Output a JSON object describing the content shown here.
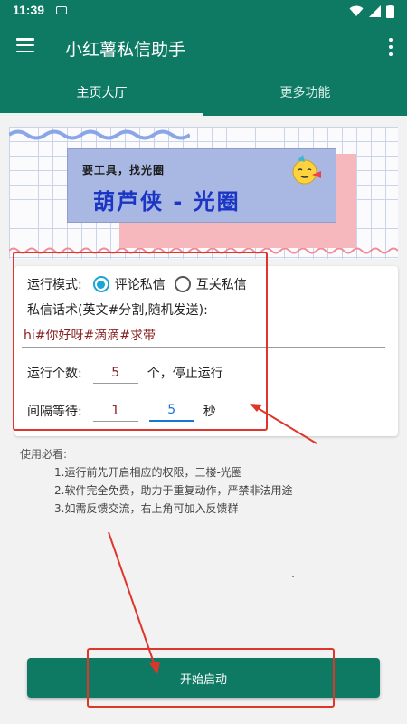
{
  "status_bar": {
    "time": "11:39"
  },
  "app_bar": {
    "title": "小红薯私信助手"
  },
  "tabs": [
    {
      "label": "主页大厅",
      "active": true
    },
    {
      "label": "更多功能",
      "active": false
    }
  ],
  "banner": {
    "small_text": "要工具，找光圈",
    "big_text": "葫芦侠 - 光圈"
  },
  "settings": {
    "mode_label": "运行模式:",
    "mode_options": [
      {
        "label": "评论私信",
        "checked": true
      },
      {
        "label": "互关私信",
        "checked": false
      }
    ],
    "message_label": "私信话术(英文#分割,随机发送):",
    "message_value": "hi#你好呀#滴滴#求带",
    "count_label": "运行个数:",
    "count_value": "5",
    "count_suffix": "个，停止运行",
    "interval_label": "间隔等待:",
    "interval_min": "1",
    "interval_max": "5",
    "interval_unit": "秒"
  },
  "notes": {
    "title": "使用必看:",
    "items": [
      "1.运行前先开启相应的权限，三楼-光圈",
      "2.软件完全免费，助力于重复动作，严禁非法用途",
      "3.如需反馈交流，右上角可加入反馈群"
    ]
  },
  "start_button": {
    "label": "开始启动"
  },
  "colors": {
    "primary": "#0e7a64",
    "radio_accent": "#1aa5d6",
    "annotation_red": "#e0352b",
    "input_text": "#8a1f1f"
  }
}
